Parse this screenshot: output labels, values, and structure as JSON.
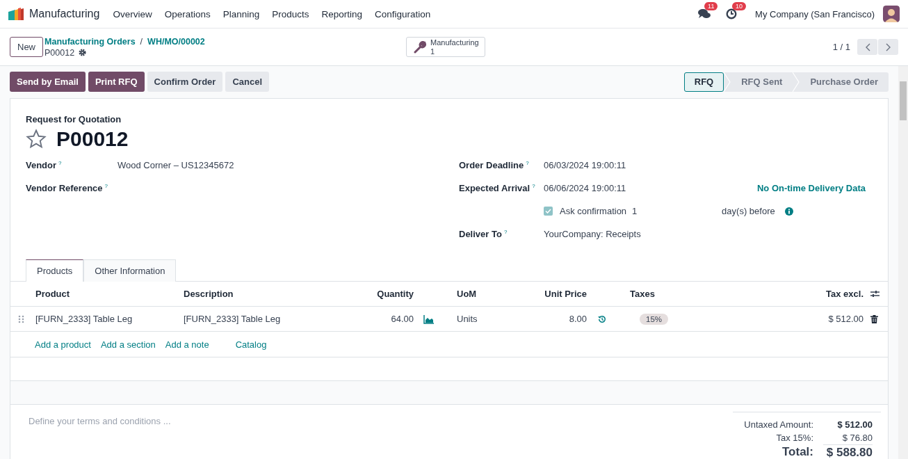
{
  "app": {
    "name": "Manufacturing"
  },
  "menu": [
    "Overview",
    "Operations",
    "Planning",
    "Products",
    "Reporting",
    "Configuration"
  ],
  "systray": {
    "messages_count": "11",
    "activities_count": "10",
    "company": "My Company (San Francisco)"
  },
  "control": {
    "new_button": "New",
    "breadcrumbs": [
      "Manufacturing Orders",
      "WH/MO/00002"
    ],
    "breadcrumb_separator": "/",
    "record": "P00012",
    "smart_button": {
      "label": "Manufacturing",
      "count": "1"
    },
    "pager": "1 / 1"
  },
  "actions": [
    {
      "label": "Send by Email",
      "primary": true
    },
    {
      "label": "Print RFQ",
      "primary": true
    },
    {
      "label": "Confirm Order",
      "primary": false
    },
    {
      "label": "Cancel",
      "primary": false
    }
  ],
  "statusbar": [
    {
      "label": "RFQ",
      "selected": true
    },
    {
      "label": "RFQ Sent",
      "selected": false
    },
    {
      "label": "Purchase Order",
      "selected": false
    }
  ],
  "form": {
    "subtitle": "Request for Quotation",
    "title": "P00012",
    "starred": false,
    "vendor": {
      "label": "Vendor",
      "help": "?",
      "value": "Wood Corner – US12345672"
    },
    "vendor_reference": {
      "label": "Vendor Reference",
      "help": "?"
    },
    "order_deadline": {
      "label": "Order Deadline",
      "help": "?",
      "value": "06/03/2024 19:00:11"
    },
    "expected_arrival": {
      "label": "Expected Arrival",
      "help": "?",
      "value": "06/06/2024 19:00:11",
      "note": "No On-time Delivery Data"
    },
    "ask_confirmation": {
      "label": "Ask confirmation",
      "checked": true,
      "days": "1",
      "suffix": "day(s) before"
    },
    "deliver_to": {
      "label": "Deliver To",
      "help": "?",
      "value": "YourCompany: Receipts"
    }
  },
  "tabs": [
    {
      "label": "Products",
      "selected": true
    },
    {
      "label": "Other Information",
      "selected": false
    }
  ],
  "table": {
    "columns": [
      "Product",
      "Description",
      "Quantity",
      "UoM",
      "Unit Price",
      "Taxes",
      "Tax excl."
    ],
    "rows": [
      {
        "product": "[FURN_2333] Table Leg",
        "description": "[FURN_2333] Table Leg",
        "quantity": "64.00",
        "uom": "Units",
        "unit_price": "8.00",
        "taxes": [
          "15%"
        ],
        "subtotal": "$ 512.00"
      }
    ],
    "add_links": [
      "Add a product",
      "Add a section",
      "Add a note",
      "Catalog"
    ]
  },
  "footer": {
    "terms_placeholder": "Define your terms and conditions ...",
    "totals": [
      {
        "label": "Untaxed Amount:",
        "value": "$ 512.00",
        "kind": "subtotal"
      },
      {
        "label": "Tax 15%:",
        "value": "$ 76.80",
        "kind": "tax"
      },
      {
        "label": "Total:",
        "value": "$ 588.80",
        "kind": "total"
      }
    ]
  }
}
